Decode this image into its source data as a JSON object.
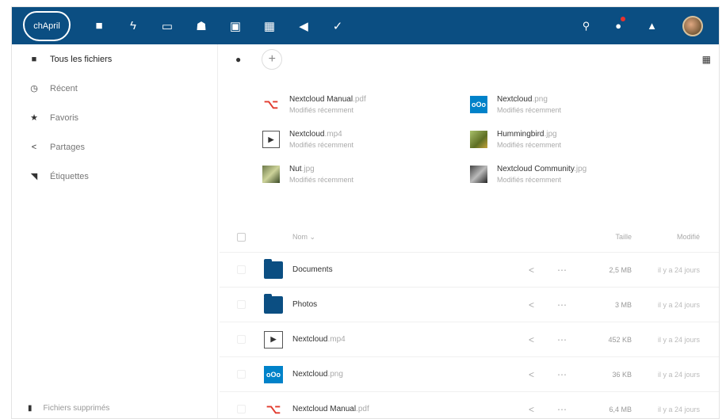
{
  "topbar": {
    "logo_text": "chApril",
    "nav_icons": [
      "folder-icon",
      "activity-icon",
      "gallery-icon",
      "contacts-icon",
      "calendar-icon",
      "notes-icon",
      "announcements-icon",
      "tasks-icon"
    ],
    "right_icons": [
      "search-icon",
      "notifications-icon",
      "contacts-menu-icon"
    ],
    "colors": {
      "bar": "#0b4e82",
      "badge": "#e9322d"
    }
  },
  "sidebar": {
    "items": [
      {
        "label": "Tous les fichiers",
        "icon": "folder-icon"
      },
      {
        "label": "Récent",
        "icon": "clock-icon"
      },
      {
        "label": "Favoris",
        "icon": "star-icon"
      },
      {
        "label": "Partages",
        "icon": "share-icon"
      },
      {
        "label": "Étiquettes",
        "icon": "tag-icon"
      }
    ],
    "bottom_label": "Fichiers supprimés"
  },
  "recent": [
    {
      "name": "Nextcloud Manual",
      "ext": ".pdf",
      "sub": "Modifiés récemment",
      "thumb": "pdf"
    },
    {
      "name": "Nextcloud",
      "ext": ".png",
      "sub": "Modifiés récemment",
      "thumb": "nc"
    },
    {
      "name": "Nextcloud",
      "ext": ".mp4",
      "sub": "Modifiés récemment",
      "thumb": "vid"
    },
    {
      "name": "Hummingbird",
      "ext": ".jpg",
      "sub": "Modifiés récemment",
      "thumb": "hb"
    },
    {
      "name": "Nut",
      "ext": ".jpg",
      "sub": "Modifiés récemment",
      "thumb": "img"
    },
    {
      "name": "Nextcloud Community",
      "ext": ".jpg",
      "sub": "Modifiés récemment",
      "thumb": "com"
    }
  ],
  "list": {
    "col_name": "Nom ⌄",
    "col_size": "Taille",
    "col_modified": "Modifié",
    "rows": [
      {
        "name": "Documents",
        "ext": "",
        "type": "folder",
        "size": "2,5 MB",
        "modified": "il y a 24 jours"
      },
      {
        "name": "Photos",
        "ext": "",
        "type": "folder",
        "size": "3 MB",
        "modified": "il y a 24 jours"
      },
      {
        "name": "Nextcloud",
        "ext": ".mp4",
        "type": "vid",
        "size": "452 KB",
        "modified": "il y a 24 jours"
      },
      {
        "name": "Nextcloud",
        "ext": ".png",
        "type": "nc",
        "size": "36 KB",
        "modified": "il y a 24 jours"
      },
      {
        "name": "Nextcloud Manual",
        "ext": ".pdf",
        "type": "pdf",
        "size": "6,4 MB",
        "modified": "il y a 24 jours"
      }
    ]
  }
}
